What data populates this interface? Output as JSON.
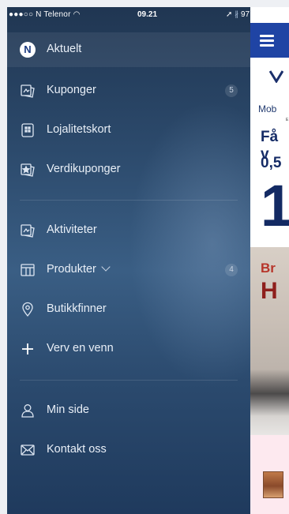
{
  "status_bar": {
    "carrier": "●●●○○ N Telenor",
    "wifi_icon": "wifi-icon",
    "time": "09.21",
    "location_icon": "➚",
    "bluetooth_icon": "∦",
    "battery": "97 %"
  },
  "menu": {
    "items": [
      {
        "label": "Aktuelt",
        "icon": "n-logo-icon",
        "logo_text": "N",
        "active": true
      },
      {
        "label": "Kuponger",
        "icon": "coupon-icon",
        "badge": "5"
      },
      {
        "label": "Lojalitetskort",
        "icon": "card-icon"
      },
      {
        "label": "Verdikuponger",
        "icon": "star-coupon-icon"
      },
      {
        "label": "Aktiviteter",
        "icon": "activity-coupon-icon"
      },
      {
        "label": "Produkter",
        "icon": "grid-icon",
        "badge": "4",
        "dropdown": "chevron-down-icon"
      },
      {
        "label": "Butikkfinner",
        "icon": "location-pin-icon"
      },
      {
        "label": "Verv en venn",
        "icon": "plus-icon"
      },
      {
        "label": "Min side",
        "icon": "user-icon"
      },
      {
        "label": "Kontakt oss",
        "icon": "envelope-icon"
      }
    ]
  },
  "content": {
    "brand": "Mob",
    "tiny_text": "E",
    "headline_1": "Få v",
    "headline_2": "0,5",
    "big_number": "1",
    "promo_line_1": "Br",
    "promo_line_2": "H"
  },
  "colors": {
    "drawer_top": "#203652",
    "drawer_mid": "#3a5e84",
    "topbar": "#1f44a4",
    "banner": "#fde9ef"
  }
}
